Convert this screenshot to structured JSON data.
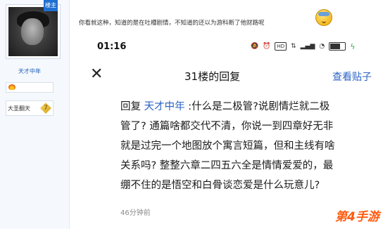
{
  "user": {
    "name": "天才中年",
    "corner_badge": "楼主",
    "title": "大圣翻天",
    "title_mark": "7"
  },
  "post": {
    "text": "你看就这种，知道的是在吐槽剧情，不知道的还以为游科断了他财路呢"
  },
  "phone": {
    "status_time": "01:16",
    "status_hd": "HD",
    "battery_level": 0.8,
    "header_title": "31楼的回复",
    "view_post": "查看贴子",
    "reply_prefix": "回复 ",
    "reply_mention": "天才中年",
    "reply_line1": " :什么是二极管?说剧情烂就二极",
    "reply_line2": "管了? 通篇啥都交代不清，你说一到四章好无非",
    "reply_line3": "就是过完一个地图放个寓言短篇，但和主线有啥",
    "reply_line4": "关系吗? 整整六章二四五六全是情情爱爱的，最",
    "reply_line5": "绷不住的是悟空和白骨谈恋爱是什么玩意儿?",
    "timestamp": "46分钟前"
  },
  "watermark": "第4手游",
  "colors": {
    "link": "#2b63c5",
    "watermark": "#ff5a0e",
    "user_name": "#1f5fb8"
  }
}
